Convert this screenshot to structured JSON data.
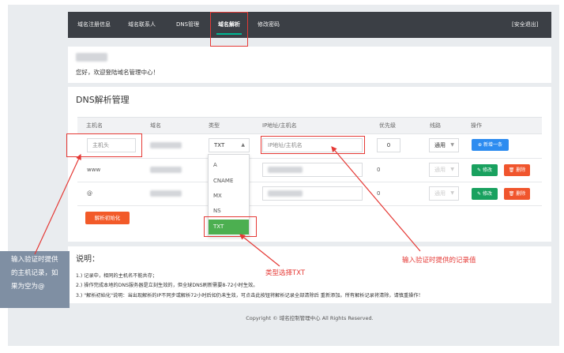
{
  "nav": {
    "items": [
      {
        "label": "域名注册信息"
      },
      {
        "label": "域名联系人"
      },
      {
        "label": "DNS管理"
      },
      {
        "label": "域名解析"
      },
      {
        "label": "修改密码"
      }
    ],
    "logout": "[安全退出]"
  },
  "welcome": {
    "greeting": "您好，欢迎登陆域名管理中心！"
  },
  "dns": {
    "title": "DNS解析管理",
    "headers": [
      "主机名",
      "域名",
      "类型",
      "IP地址/主机名",
      "优先级",
      "线路",
      "操作"
    ],
    "new_row": {
      "host_placeholder": "主机头",
      "type_value": "TXT",
      "ip_placeholder": "IP地址/主机名",
      "priority": "0",
      "line": "通用",
      "add_button": "新增一条"
    },
    "rows": [
      {
        "host": "www",
        "priority": "0",
        "line": "通用",
        "edit": "修改",
        "delete": "删除"
      },
      {
        "host": "@",
        "priority": "0",
        "line": "通用",
        "edit": "修改",
        "delete": "删除"
      }
    ],
    "type_options": [
      "A",
      "CNAME",
      "MX",
      "NS",
      "TXT"
    ],
    "init_button": "解析初始化"
  },
  "notes": {
    "title": "说明：",
    "lines": [
      "1.) 记录中，相同的主机名不能共存；",
      "2.) 操作完成本地的DNS服务器是立刻生效的，但全球DNS刷新需要8-72小时生效。",
      "3.) \"解析初始化\"说明：当出现解析的IP不同步或解析72小时后如仍未生效，可点击此按钮将解析记录全部清除后 重新添加。所有解析记录将清除，请慎重操作！"
    ]
  },
  "annotations": {
    "left_lines": [
      "输入验证时提供",
      "的主机记录，如",
      "果为空为@"
    ],
    "type_note": "类型选择TXT",
    "value_note": "输入验证时提供的记录值"
  },
  "footer": "Copyright © 域名控制管理中心 All Rights Reserved.",
  "colors": {
    "nav_bg": "#3b3f45",
    "annotation": "#e53935",
    "txt_option": "#4caf50",
    "add_button": "#2d8cf0"
  }
}
